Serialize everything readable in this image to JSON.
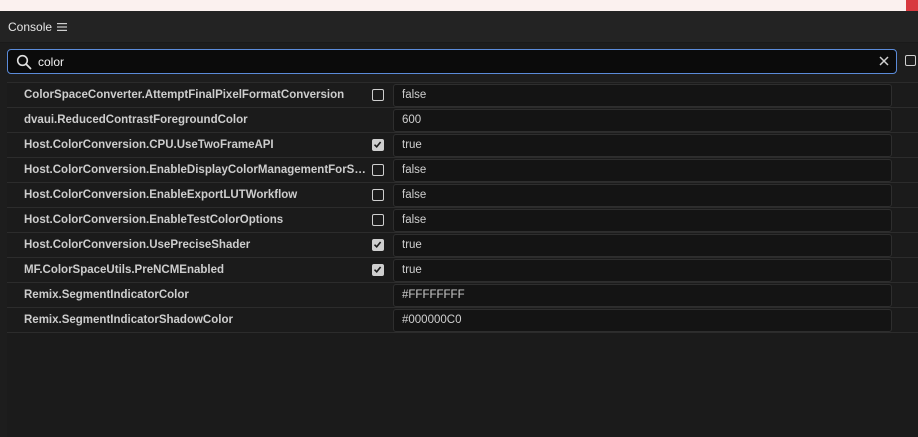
{
  "panel": {
    "title": "Console"
  },
  "search": {
    "value": "color"
  },
  "rows": [
    {
      "name": "ColorSpaceConverter.AttemptFinalPixelFormatConversion",
      "value": "false",
      "checkbox": "unchecked"
    },
    {
      "name": "dvaui.ReducedContrastForegroundColor",
      "value": "600",
      "checkbox": "none"
    },
    {
      "name": "Host.ColorConversion.CPU.UseTwoFrameAPI",
      "value": "true",
      "checkbox": "checked"
    },
    {
      "name": "Host.ColorConversion.EnableDisplayColorManagementForSWRen...",
      "value": "false",
      "checkbox": "unchecked"
    },
    {
      "name": "Host.ColorConversion.EnableExportLUTWorkflow",
      "value": "false",
      "checkbox": "unchecked"
    },
    {
      "name": "Host.ColorConversion.EnableTestColorOptions",
      "value": "false",
      "checkbox": "unchecked"
    },
    {
      "name": "Host.ColorConversion.UsePreciseShader",
      "value": "true",
      "checkbox": "checked"
    },
    {
      "name": "MF.ColorSpaceUtils.PreNCMEnabled",
      "value": "true",
      "checkbox": "checked"
    },
    {
      "name": "Remix.SegmentIndicatorColor",
      "value": "#FFFFFFFF",
      "checkbox": "none"
    },
    {
      "name": "Remix.SegmentIndicatorShadowColor",
      "value": "#000000C0",
      "checkbox": "none"
    }
  ],
  "colors": {
    "accent": "#5b8bd9",
    "background": "#1d1d1d",
    "close_button": "#d8393f"
  },
  "icons": {
    "menu": "hamburger-menu-icon",
    "search": "search-icon",
    "clear": "close-icon",
    "checkbox_checked": "checkmark-icon"
  }
}
